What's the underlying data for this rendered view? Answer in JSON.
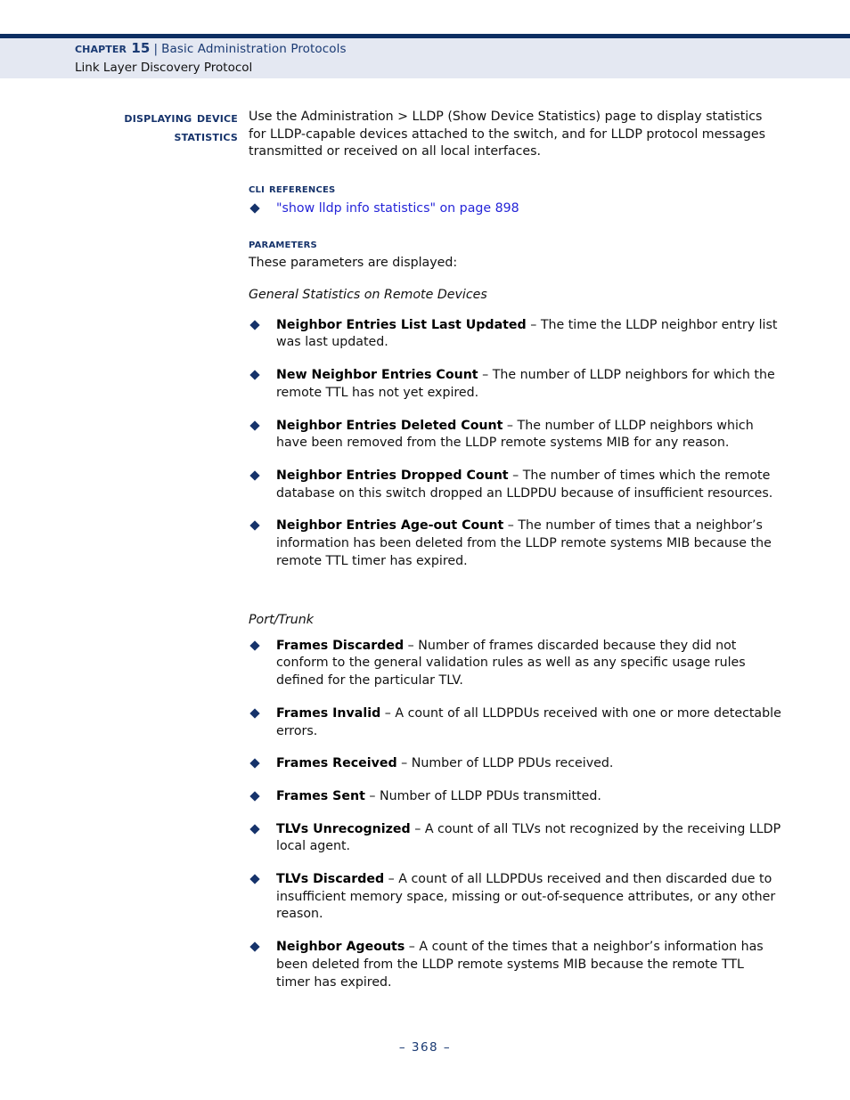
{
  "header": {
    "chapter": "Chapter 15",
    "separator": "|",
    "chapter_title": "Basic Administration Protocols",
    "section_title": "Link Layer Discovery Protocol",
    "rule_color": "#0d2e62",
    "band_color": "#e4e8f2",
    "heading_color": "#1a3a73"
  },
  "margin_heading": "Displaying Device Statistics",
  "intro_paragraph": "Use the Administration > LLDP (Show Device Statistics) page to display statistics for LLDP-capable devices attached to the switch, and for LLDP protocol messages transmitted or received on all local interfaces.",
  "cli_references": {
    "heading": "CLI References",
    "links": [
      "\"show lldp info statistics\" on page 898"
    ],
    "link_color": "#2424d8"
  },
  "parameters": {
    "heading": "Parameters",
    "lead_in": "These parameters are displayed:",
    "groups": [
      {
        "subheading": "General Statistics on Remote Devices",
        "items": [
          {
            "term": "Neighbor Entries List Last Updated",
            "dash": " – ",
            "description": "The time the LLDP neighbor entry list was last updated."
          },
          {
            "term": "New Neighbor Entries Count",
            "dash": " – ",
            "description": "The number of LLDP neighbors for which the remote TTL has not yet expired."
          },
          {
            "term": "Neighbor Entries Deleted Count",
            "dash": " – ",
            "description": "The number of LLDP neighbors which have been removed from the LLDP remote systems MIB for any reason."
          },
          {
            "term": "Neighbor Entries Dropped Count",
            "dash": " – ",
            "description": "The number of times which the remote database on this switch dropped an LLDPDU because of insufficient resources."
          },
          {
            "term": "Neighbor Entries Age-out Count",
            "dash": " – ",
            "description": "The number of times that a neighbor’s information has been deleted from the LLDP remote systems MIB because the remote TTL timer has expired."
          }
        ]
      },
      {
        "subheading": "Port/Trunk",
        "items": [
          {
            "term": "Frames Discarded",
            "dash": " – ",
            "description": "Number of frames discarded because they did not conform to the general validation rules as well as any specific usage rules defined for the particular TLV."
          },
          {
            "term": "Frames Invalid",
            "dash": " – ",
            "description": "A count of all LLDPDUs received with one or more detectable errors."
          },
          {
            "term": "Frames Received",
            "dash": " – ",
            "description": "Number of LLDP PDUs received."
          },
          {
            "term": "Frames Sent",
            "dash": " – ",
            "description": "Number of LLDP PDUs transmitted."
          },
          {
            "term": "TLVs Unrecognized",
            "dash": " – ",
            "description": "A count of all TLVs not recognized by the receiving LLDP local agent."
          },
          {
            "term": "TLVs Discarded",
            "dash": " – ",
            "description": "A count of all LLDPDUs received and then discarded due to insufficient memory space, missing or out-of-sequence attributes, or any other reason."
          },
          {
            "term": "Neighbor Ageouts",
            "dash": " – ",
            "description": "A count of the times that a neighbor’s information has been deleted from the LLDP remote systems MIB because the remote TTL timer has expired."
          }
        ]
      }
    ]
  },
  "footer": {
    "page_number": "–  368  –"
  }
}
